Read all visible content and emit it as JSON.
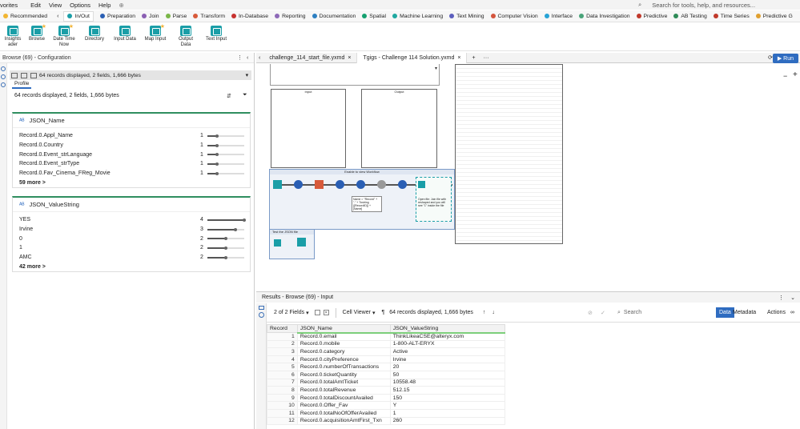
{
  "menu": {
    "items": [
      "Edit",
      "View",
      "Options",
      "Help"
    ],
    "partial": "vorites",
    "search_placeholder": "Search for tools, help, and resources..."
  },
  "categories": [
    {
      "label": "Recommended",
      "color": "#f2b632"
    },
    {
      "label": "In/Out",
      "color": "#1a9ea7"
    },
    {
      "label": "Preparation",
      "color": "#2a5fb4"
    },
    {
      "label": "Join",
      "color": "#8b5fb3"
    },
    {
      "label": "Parse",
      "color": "#7ab648"
    },
    {
      "label": "Transform",
      "color": "#d85a3a"
    },
    {
      "label": "In-Database",
      "color": "#c7322f"
    },
    {
      "label": "Reporting",
      "color": "#8e6ab8"
    },
    {
      "label": "Documentation",
      "color": "#2d7fc1"
    },
    {
      "label": "Spatial",
      "color": "#14a06f"
    },
    {
      "label": "Machine Learning",
      "color": "#1fa8a0"
    },
    {
      "label": "Text Mining",
      "color": "#5d5fbe"
    },
    {
      "label": "Computer Vision",
      "color": "#d4553d"
    },
    {
      "label": "Interface",
      "color": "#27a3d6"
    },
    {
      "label": "Data Investigation",
      "color": "#4aa47a"
    },
    {
      "label": "Predictive",
      "color": "#c0392b"
    },
    {
      "label": "AB Testing",
      "color": "#2e8b57"
    },
    {
      "label": "Time Series",
      "color": "#c0392b"
    },
    {
      "label": "Predictive G",
      "color": "#e0a030"
    }
  ],
  "tools": [
    {
      "label": "Insights\nader"
    },
    {
      "label": "Browse"
    },
    {
      "label": "Date Time\nNow"
    },
    {
      "label": "Directory"
    },
    {
      "label": "Input Data"
    },
    {
      "label": "Map Input"
    },
    {
      "label": "Output Data"
    },
    {
      "label": "Text Input"
    }
  ],
  "left": {
    "title": "Browse (69) - Configuration",
    "records": "64 records displayed, 2 fields, 1,666 bytes",
    "profile_label": "Profile",
    "card1": {
      "title": "JSON_Name",
      "rows": [
        {
          "name": "Record.0.Appl_Name",
          "count": "1",
          "frac": 0.25
        },
        {
          "name": "Record.0.Country",
          "count": "1",
          "frac": 0.25
        },
        {
          "name": "Record.0.Event_strLanguage",
          "count": "1",
          "frac": 0.25
        },
        {
          "name": "Record.0.Event_strType",
          "count": "1",
          "frac": 0.25
        },
        {
          "name": "Record.0.Fav_Cinema_FReg_Movie",
          "count": "1",
          "frac": 0.25
        }
      ],
      "more": "59 more >"
    },
    "card2": {
      "title": "JSON_ValueString",
      "rows": [
        {
          "name": "YES",
          "count": "4",
          "frac": 1.0
        },
        {
          "name": "Irvine",
          "count": "3",
          "frac": 0.75
        },
        {
          "name": "0",
          "count": "2",
          "frac": 0.5
        },
        {
          "name": "1",
          "count": "2",
          "frac": 0.5
        },
        {
          "name": "AMC",
          "count": "2",
          "frac": 0.5
        }
      ],
      "more": "42 more >"
    }
  },
  "tabs": [
    {
      "label": "challenge_114_start_file.yxmd"
    },
    {
      "label": "Tgigs - Challenge 114 Solution.yxmd"
    }
  ],
  "run_label": "Run",
  "canvas": {
    "box1": "Input",
    "box2": "Output",
    "container1": "Enable to view Workflow",
    "container2": "Test the JSON file",
    "comment": "Name = \"Record\" + \".\" + Tostring ([RecordID]) + [Name]",
    "comment2": "Open file: Join file with reshaped and you will see \"1\" inside the file"
  },
  "results": {
    "title": "Results - Browse (69) - Input",
    "fields_label": "2 of 2 Fields",
    "viewer_label": "Cell Viewer",
    "records": "64 records displayed, 1,666 bytes",
    "search_placeholder": "Search",
    "data_btn": "Data",
    "metadata_btn": "Metadata",
    "actions_btn": "Actions",
    "columns": [
      "Record",
      "JSON_Name",
      "JSON_ValueString"
    ],
    "rows": [
      [
        "1",
        "Record.0.email",
        "ThinkLikeaCSE@alteryx.com"
      ],
      [
        "2",
        "Record.0.mobile",
        "1-800-ALT-ERYX"
      ],
      [
        "3",
        "Record.0.category",
        "Active"
      ],
      [
        "4",
        "Record.0.cityPreference",
        "Irvine"
      ],
      [
        "5",
        "Record.0.numberOfTransactions",
        "20"
      ],
      [
        "6",
        "Record.0.ticketQuantity",
        "50"
      ],
      [
        "7",
        "Record.0.totalAmtTicket",
        "10558.48"
      ],
      [
        "8",
        "Record.0.totalRevenue",
        "512.15"
      ],
      [
        "9",
        "Record.0.totalDiscountAvailed",
        "150"
      ],
      [
        "10",
        "Record.0.Offer_Fav",
        "Y"
      ],
      [
        "11",
        "Record.0.totalNoOfOfferAvailed",
        "1"
      ],
      [
        "12",
        "Record.0.acquisitionAmtFirst_Txn",
        "260"
      ]
    ]
  }
}
